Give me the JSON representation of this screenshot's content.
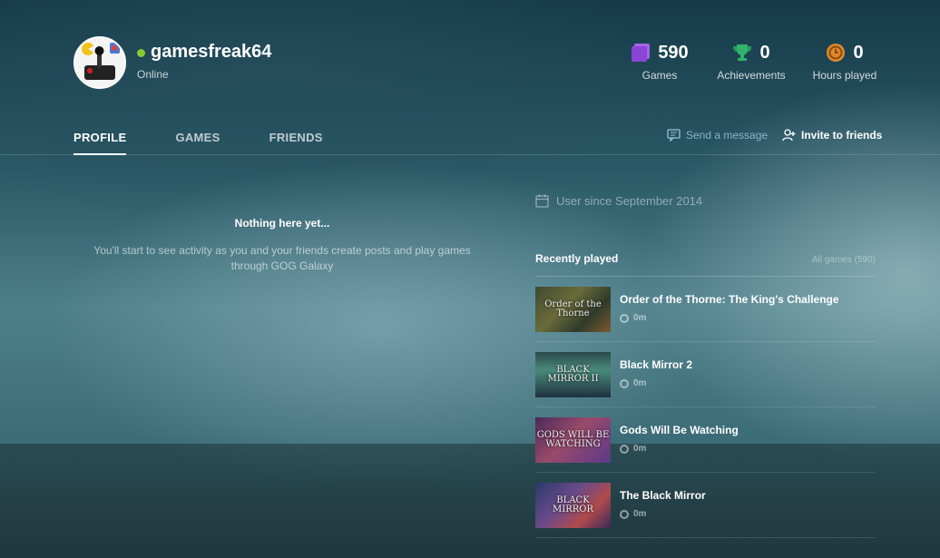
{
  "profile": {
    "username": "gamesfreak64",
    "status": "Online",
    "status_color": "#8ac832"
  },
  "stats": {
    "games": {
      "value": "590",
      "label": "Games",
      "icon": "games-icon"
    },
    "achievements": {
      "value": "0",
      "label": "Achievements",
      "icon": "trophy-icon"
    },
    "hours": {
      "value": "0",
      "label": "Hours played",
      "icon": "clock-icon"
    }
  },
  "tabs": [
    {
      "label": "PROFILE",
      "active": true
    },
    {
      "label": "GAMES",
      "active": false
    },
    {
      "label": "FRIENDS",
      "active": false
    }
  ],
  "actions": {
    "send_message": "Send a message",
    "invite": "Invite to friends"
  },
  "activity": {
    "empty_title": "Nothing here yet...",
    "empty_desc": "You'll start to see activity as you and your friends create posts and play games through GOG Galaxy"
  },
  "user_since": "User since September 2014",
  "recently_played": {
    "title": "Recently played",
    "all_games": "All games (590)",
    "games": [
      {
        "name": "Order of the Thorne: The King's Challenge",
        "time": "0m",
        "thumb_text": "Order of the Thorne"
      },
      {
        "name": "Black Mirror 2",
        "time": "0m",
        "thumb_text": "BLACK MIRROR II"
      },
      {
        "name": "Gods Will Be Watching",
        "time": "0m",
        "thumb_text": "GODS WILL BE WATCHING"
      },
      {
        "name": "The Black Mirror",
        "time": "0m",
        "thumb_text": "BLACK MIRROR"
      }
    ]
  },
  "colors": {
    "games_purple": "#8b45d6",
    "trophy_green": "#2fb36e",
    "hours_orange": "#e08a2a",
    "send_message_blue": "#96c3dc"
  }
}
